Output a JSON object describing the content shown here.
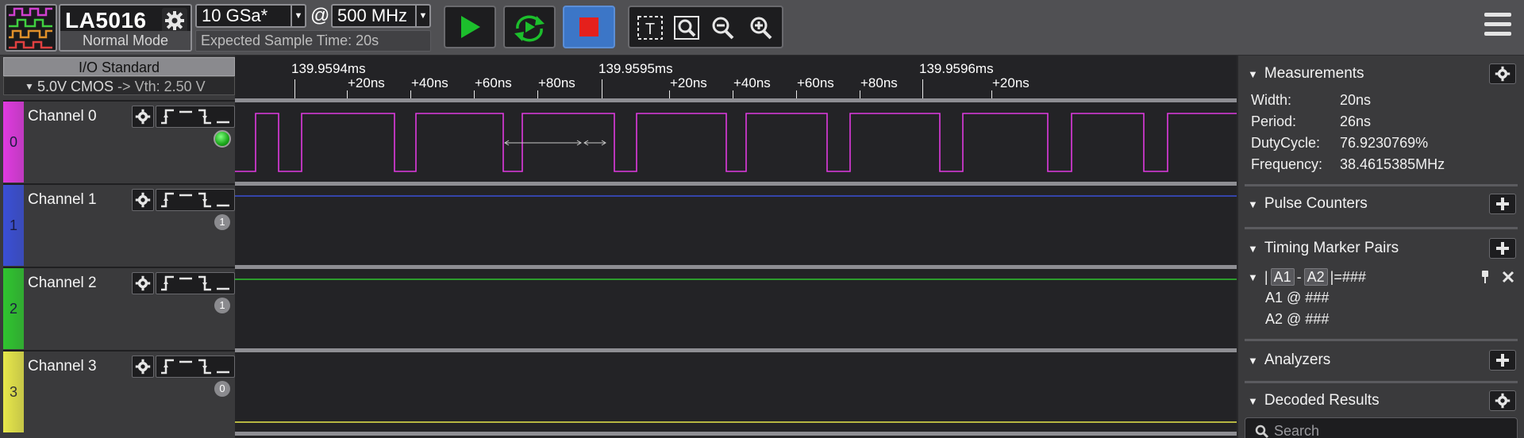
{
  "toolbar": {
    "device_name": "LA5016",
    "mode": "Normal Mode",
    "sample_rate": "10 GSa*",
    "at_symbol": "@",
    "bandwidth": "500 MHz",
    "expected_time": "Expected Sample Time: 20s",
    "icons": [
      "settings-gear-icon",
      "play-icon",
      "repeat-run-icon",
      "stop-icon",
      "text-tool-icon",
      "zoom-fit-icon",
      "zoom-out-icon",
      "zoom-in-icon",
      "hamburger-menu-icon"
    ],
    "colors": {
      "play": "#1cbf2c",
      "stop": "#e5201c",
      "stop_bg": "#3c76c7"
    }
  },
  "io": {
    "header": "I/O Standard",
    "standard": "5.0V CMOS",
    "arrow": "->",
    "vth": "Vth: 2.50 V"
  },
  "channels": [
    {
      "name": "Channel 0",
      "index": "0",
      "color": "#e03ae0",
      "badge": "",
      "active": true
    },
    {
      "name": "Channel 1",
      "index": "1",
      "color": "#3a4fd6",
      "badge": "1",
      "active": false
    },
    {
      "name": "Channel 2",
      "index": "2",
      "color": "#2fc52f",
      "badge": "1",
      "active": false
    },
    {
      "name": "Channel 3",
      "index": "3",
      "color": "#e8e84a",
      "badge": "0",
      "active": false
    }
  ],
  "ruler": {
    "labels": [
      "139.9594ms",
      "+20ns",
      "+40ns",
      "+60ns",
      "+80ns",
      "139.9595ms",
      "+20ns",
      "+40ns",
      "+60ns",
      "+80ns",
      "139.9596ms",
      "+20ns"
    ]
  },
  "measurements": {
    "title": "Measurements",
    "rows": [
      {
        "key": "Width:",
        "value": "20ns"
      },
      {
        "key": "Period:",
        "value": "26ns"
      },
      {
        "key": "DutyCycle:",
        "value": "76.9230769%"
      },
      {
        "key": "Frequency:",
        "value": "38.4615385MHz"
      }
    ]
  },
  "pulse_counters": {
    "title": "Pulse Counters"
  },
  "timing_markers": {
    "title": "Timing Marker Pairs",
    "pair_a1": "A1",
    "pair_dash": "-",
    "pair_a2": "A2",
    "pair_result": "=###",
    "a1_line": "A1 @ ###",
    "a2_line": "A2 @ ###"
  },
  "analyzers": {
    "title": "Analyzers"
  },
  "decoded": {
    "title": "Decoded Results",
    "search_placeholder": "Search"
  }
}
